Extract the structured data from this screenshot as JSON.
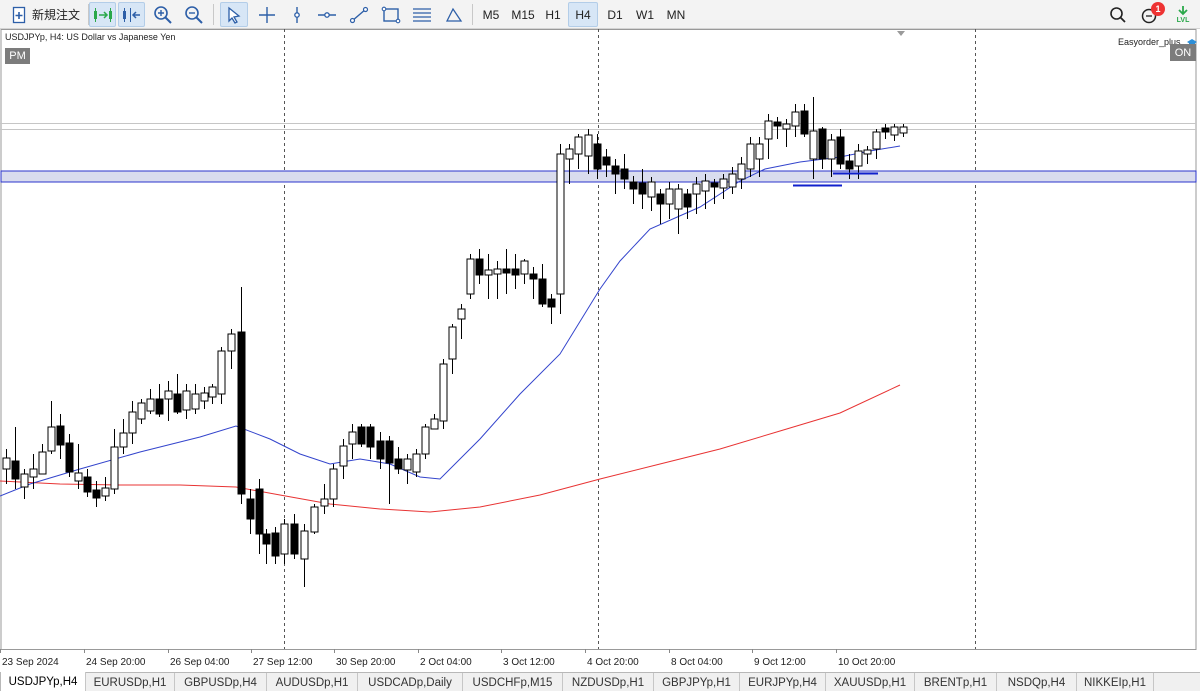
{
  "toolbar": {
    "new_order_label": "新規注文",
    "timeframes": [
      "M5",
      "M15",
      "H1",
      "H4",
      "D1",
      "W1",
      "MN"
    ],
    "active_timeframe": "H4",
    "notification_count": "1",
    "level_label": "LVL",
    "tools": [
      "algo-trading-icon",
      "autoscroll-icon",
      "zoom-in-icon",
      "zoom-out-icon",
      "cursor-icon",
      "crosshair-icon",
      "vertical-line-icon",
      "horizontal-line-icon",
      "trendline-icon",
      "rectangle-icon",
      "fibonacci-icon",
      "triangle-icon"
    ],
    "right_icons": [
      "search-icon",
      "notifications-icon",
      "level-icon"
    ]
  },
  "chart": {
    "title": "USDJPYp, H4:  US Dollar vs Japanese Yen",
    "pm_badge": "PM",
    "ea_name": "Easyorder_plus",
    "ea_status": "ON",
    "x_labels": [
      "23 Sep 2024",
      "24 Sep 20:00",
      "26 Sep 04:00",
      "27 Sep 12:00",
      "30 Sep 20:00",
      "2 Oct 04:00",
      "3 Oct 12:00",
      "4 Oct 20:00",
      "8 Oct 04:00",
      "9 Oct 12:00",
      "10 Oct 20:00"
    ],
    "colors": {
      "bull_fill": "#ffffff",
      "bear_fill": "#000000",
      "fast_ma": "#3344cc",
      "slow_ma": "#e83333",
      "zone_fill": "#d9dcee",
      "zone_border": "#2b35cc",
      "support_lines": "#1020cc",
      "grid": "#555555"
    }
  },
  "tabs": [
    "USDJPYp,H4",
    "EURUSDp,H1",
    "GBPUSDp,H4",
    "AUDUSDp,H1",
    "USDCADp,Daily",
    "USDCHFp,M15",
    "NZDUSDp,H1",
    "GBPJPYp,H1",
    "EURJPYp,H4",
    "XAUUSDp,H1",
    "BRENTp,H1",
    "NSDQp,H4",
    "NIKKEIp,H1"
  ],
  "active_tab": 0
}
